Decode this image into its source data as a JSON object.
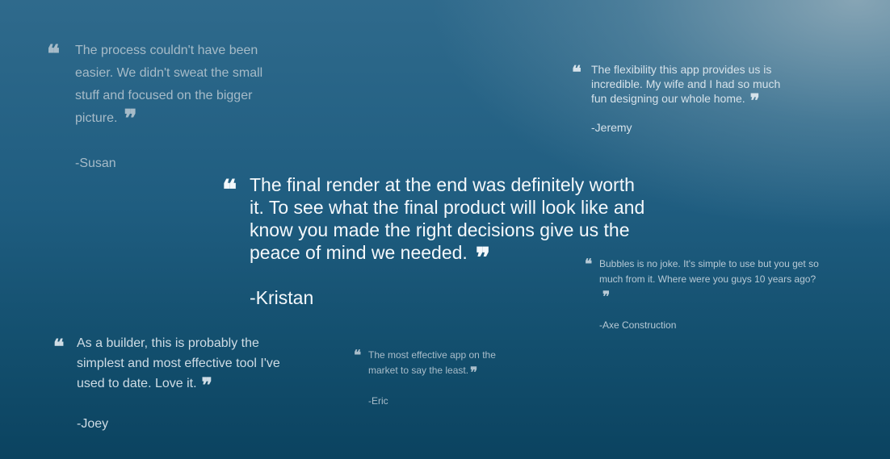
{
  "quote_marks": {
    "open": "❝",
    "close": "❞"
  },
  "testimonials": [
    {
      "text": "The process couldn't have been easier.  We didn't sweat the small stuff and focused on the bigger picture.",
      "author": "-Susan"
    },
    {
      "text": "The flexibility this app provides us is incredible.  My wife and I had so much fun designing our whole home.",
      "author": "-Jeremy"
    },
    {
      "text": "The final render at the end was definitely worth it.  To see what the final product will look like and know you made the right decisions give us the peace of mind we needed.",
      "author": "-Kristan"
    },
    {
      "text": "Bubbles is no joke.  It's simple to use but you get so much from it.  Where were you guys 10 years ago?",
      "author": "-Axe Construction"
    },
    {
      "text": "As a builder, this is probably the simplest and most effective tool I've used to date.  Love it.",
      "author": "-Joey"
    },
    {
      "text": "The most effective app on the market to say the least.",
      "author": "-Eric"
    }
  ],
  "colors": {
    "background_top": "#2f6a8c",
    "background_bottom": "#0b4360",
    "highlight": "#96afbc",
    "featured_text": "#f4f8fb"
  }
}
